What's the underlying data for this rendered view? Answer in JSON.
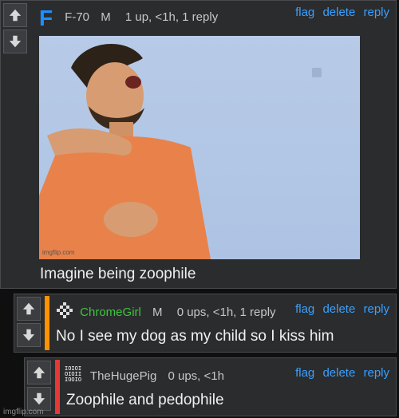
{
  "comments": [
    {
      "avatar_letter": "F",
      "user": "F-70",
      "gender": "M",
      "meta": "1 up, <1h, 1 reply",
      "actions": [
        "flag",
        "delete",
        "reply"
      ],
      "text": "Imagine being zoophile",
      "image": {
        "watermark": "imgflip.com"
      }
    },
    {
      "user": "ChromeGirl",
      "gender": "M",
      "meta": "0 ups, <1h, 1 reply",
      "actions": [
        "flag",
        "delete",
        "reply"
      ],
      "text": "No I see my dog as my child so I kiss him",
      "accent_color": "#ff9200",
      "user_color": "#3ec43e"
    },
    {
      "avatar_text": "IOIOI OIOII IOOIO",
      "user": "TheHugePig",
      "meta": "0 ups, <1h",
      "actions": [
        "flag",
        "delete",
        "reply"
      ],
      "text": "Zoophile and pedophile",
      "accent_color": "#e53935"
    }
  ],
  "footer": {
    "watermark": "imgflip.com"
  }
}
